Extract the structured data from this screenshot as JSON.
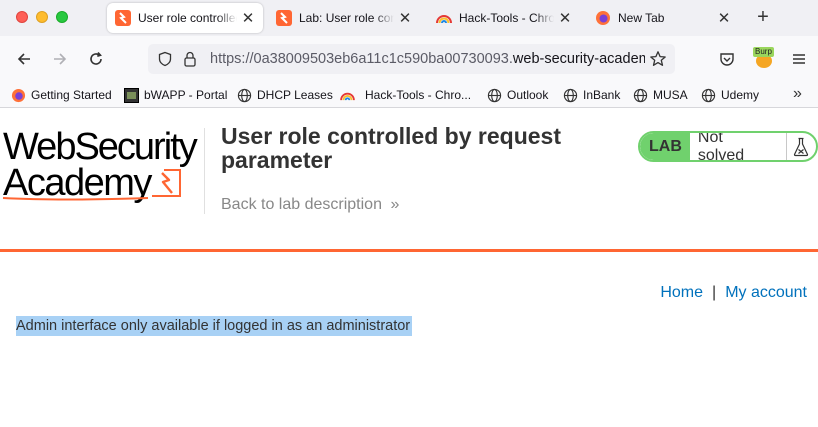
{
  "browser": {
    "tabs": [
      {
        "title": "User role controlled",
        "favicon": "portswigger-icon",
        "active": true
      },
      {
        "title": "Lab: User role contr",
        "favicon": "portswigger-icon",
        "active": false
      },
      {
        "title": "Hack-Tools - Chrom",
        "favicon": "rainbow-icon",
        "active": false
      },
      {
        "title": "New Tab",
        "favicon": "firefox-icon",
        "active": false
      }
    ],
    "url_prefix": "https://0a38009503eb6a11c1c590ba00730093.",
    "url_host": "web-security-academy.net",
    "extension_label": "Burp",
    "bookmarks": [
      {
        "label": "Getting Started",
        "icon": "firefox-icon"
      },
      {
        "label": "bWAPP - Portal",
        "icon": "bwapp-icon"
      },
      {
        "label": "DHCP Leases",
        "icon": "globe-icon"
      },
      {
        "label": "Hack-Tools - Chro...",
        "icon": "rainbow-icon"
      },
      {
        "label": "Outlook",
        "icon": "globe-icon"
      },
      {
        "label": "InBank",
        "icon": "globe-icon"
      },
      {
        "label": "MUSA",
        "icon": "globe-icon"
      },
      {
        "label": "Udemy",
        "icon": "globe-icon"
      }
    ],
    "overflow_label": "»"
  },
  "page": {
    "logo_line1": "WebSecurity",
    "logo_line2": "Academy",
    "lab_title": "User role controlled by request parameter",
    "back_link": "Back to lab description",
    "back_arrow": "»",
    "lab_badge": "LAB",
    "lab_state": "Not solved",
    "nav_home": "Home",
    "nav_sep": "|",
    "nav_account": "My account",
    "admin_message": "Admin interface only available if logged in as an administrator"
  },
  "colors": {
    "accent_orange": "#ff6633",
    "lab_green": "#70d16d",
    "link_blue": "#0071bc",
    "selection_blue": "#a8d1f5"
  }
}
